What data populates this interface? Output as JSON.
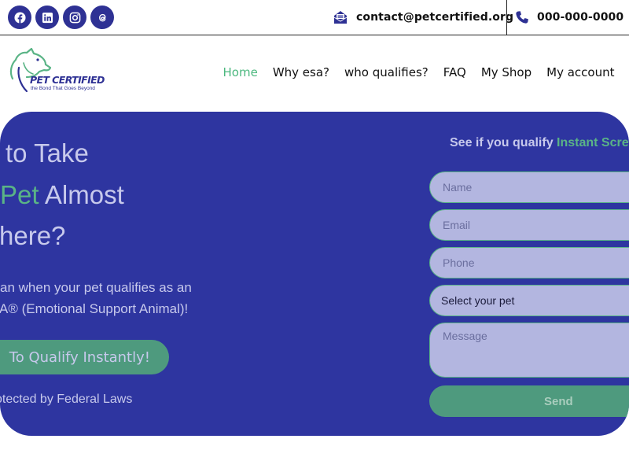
{
  "topbar": {
    "social": [
      {
        "icon": "facebook-icon"
      },
      {
        "icon": "linkedin-icon"
      },
      {
        "icon": "instagram-icon"
      },
      {
        "icon": "threads-icon"
      }
    ],
    "email": "contact@petcertified.org",
    "phone": "000-000-0000"
  },
  "logo": {
    "title": "PET CERTIFIED",
    "tagline": "the Bond That Goes Beyond"
  },
  "nav": {
    "items": [
      "Home",
      "Why esa?",
      "who qualifies?",
      "FAQ",
      "My Shop",
      "My account"
    ],
    "active_index": 0
  },
  "hero": {
    "line1": "to Take",
    "line2_green": "Pet",
    "line2_rest": " Almost",
    "line3": "here?",
    "sub1": "an when your pet qualifies as an",
    "sub2": "A® (Emotional Support Animal)!",
    "cta": "To Qualify Instantly!",
    "protected": "otected by Federal Laws"
  },
  "form": {
    "title_plain": "See if you qualify ",
    "title_green": "Instant Scre",
    "name_placeholder": "Name",
    "email_placeholder": "Email",
    "phone_placeholder": "Phone",
    "select_value": "Select your pet",
    "message_placeholder": "Message",
    "send_label": "Send"
  },
  "colors": {
    "brand_blue": "#2e3194",
    "hero_bg": "#2e35a0",
    "accent_green": "#4cb87f",
    "button_green": "#4e9a7e"
  }
}
